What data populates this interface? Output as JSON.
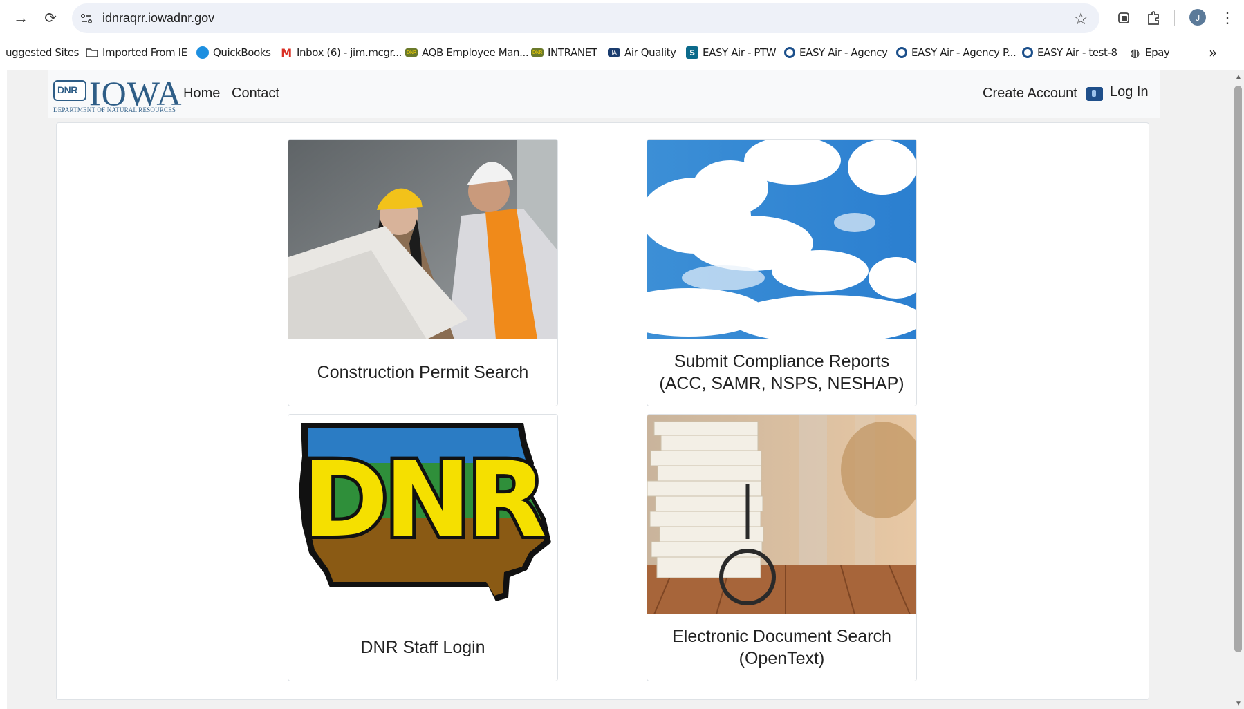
{
  "browser": {
    "url": "idnraqrr.iowadnr.gov",
    "profile_initial": "J",
    "bookmarks": [
      {
        "label": "uggested Sites",
        "icon": "none"
      },
      {
        "label": "Imported From IE",
        "icon": "folder-icon"
      },
      {
        "label": "QuickBooks",
        "icon": "quickbooks-icon"
      },
      {
        "label": "Inbox (6) - jim.mcgr...",
        "icon": "gmail-icon"
      },
      {
        "label": "AQB Employee Man...",
        "icon": "dnr-icon"
      },
      {
        "label": "INTRANET",
        "icon": "dnr-icon"
      },
      {
        "label": "Air Quality",
        "icon": "iowa-icon"
      },
      {
        "label": "EASY Air - PTW",
        "icon": "sharepoint-icon"
      },
      {
        "label": "EASY Air - Agency",
        "icon": "circle-icon"
      },
      {
        "label": "EASY Air - Agency P...",
        "icon": "circle-icon"
      },
      {
        "label": "EASY Air - test-8",
        "icon": "circle-icon"
      },
      {
        "label": "Epay",
        "icon": "globe-icon"
      }
    ],
    "overflow_label": "»"
  },
  "site": {
    "logo_word": "IOWA",
    "logo_mark": "DNR",
    "logo_sub": "DEPARTMENT OF NATURAL RESOURCES",
    "nav": {
      "home": "Home",
      "contact": "Contact"
    },
    "account": {
      "create": "Create Account",
      "login": "Log In"
    }
  },
  "tiles": [
    {
      "line1": "Construction Permit Search",
      "line2": ""
    },
    {
      "line1": "Submit Compliance Reports",
      "line2": "(ACC, SAMR, NSPS, NESHAP)"
    },
    {
      "line1": "DNR Staff Login",
      "line2": ""
    },
    {
      "line1": "Electronic Document Search",
      "line2": "(OpenText)"
    }
  ],
  "tile_images": {
    "dnr_logo_text": "DNR"
  },
  "colors": {
    "brand_blue": "#2e5d86",
    "header_bg": "#f8f9fa",
    "page_bg": "#f1f1f1"
  }
}
